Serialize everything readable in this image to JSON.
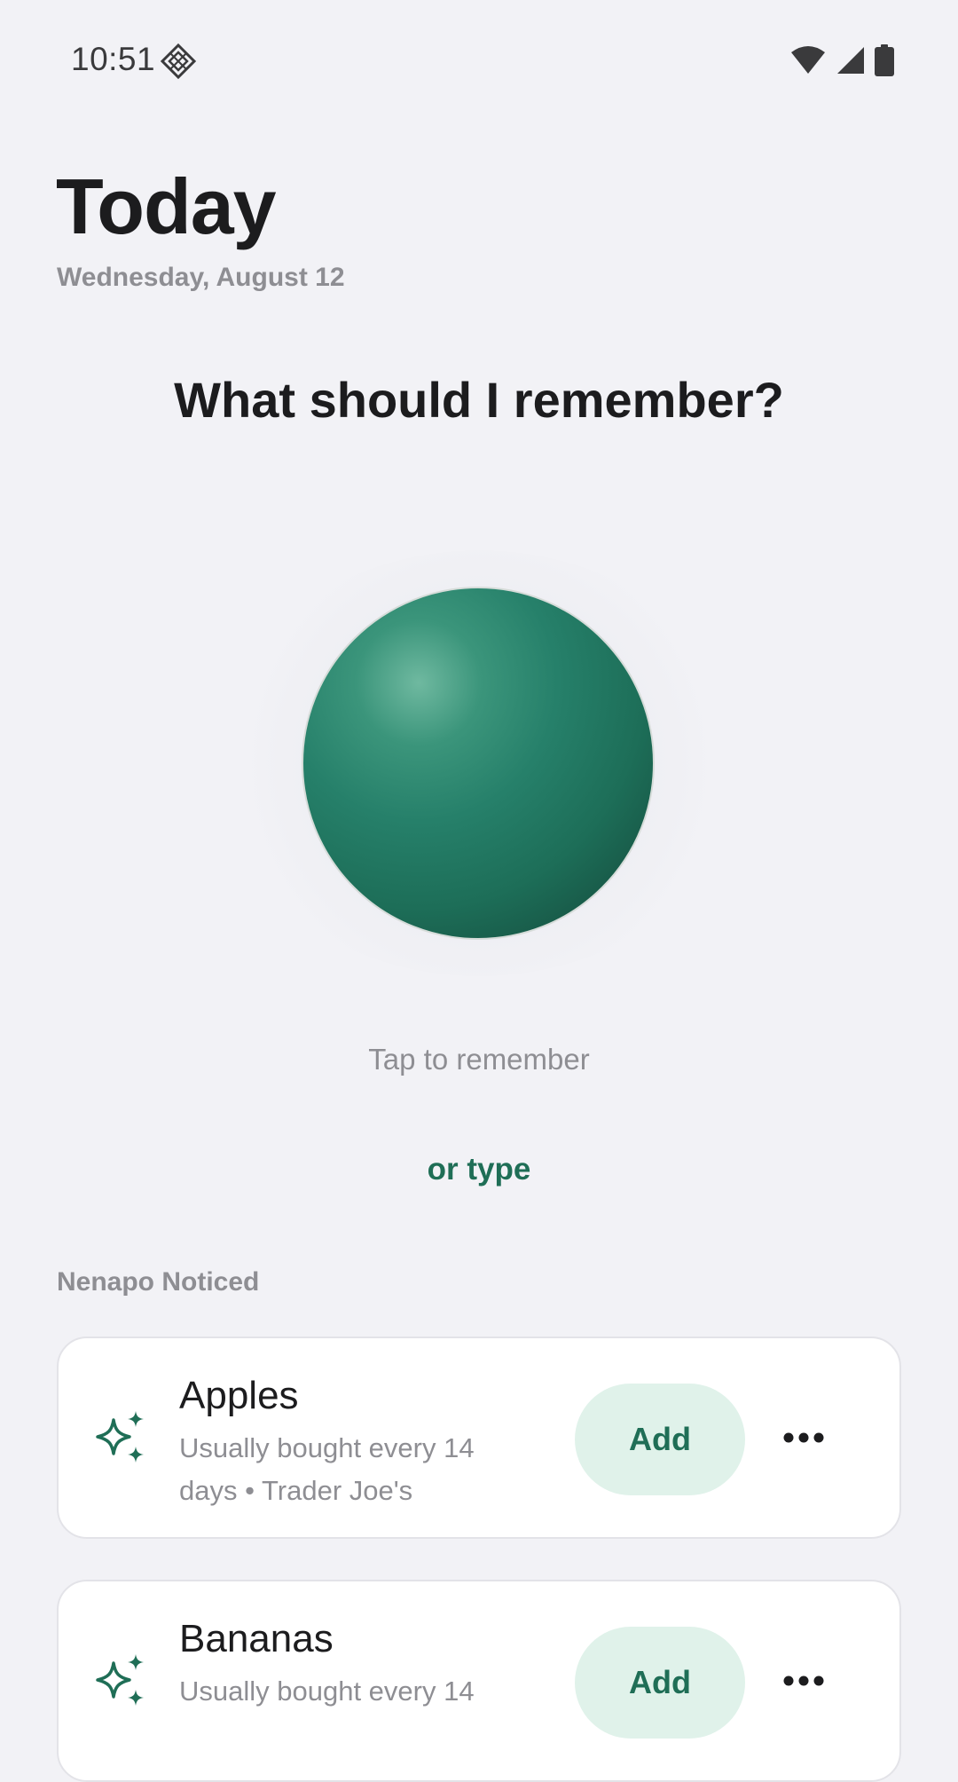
{
  "status_bar": {
    "time": "10:51",
    "app_icon": "diamond-grid-icon",
    "wifi_icon": "wifi-icon",
    "signal_icon": "cell-signal-icon",
    "battery_icon": "battery-icon"
  },
  "header": {
    "title": "Today",
    "date": "Wednesday, August 12"
  },
  "prompt": {
    "heading": "What should I remember?",
    "tap_hint": "Tap to remember",
    "type_link": "or type"
  },
  "noticed": {
    "section_label": "Nenapo Noticed",
    "items": [
      {
        "name": "Apples",
        "detail": "Usually bought every 14 days • Trader Joe's",
        "add_label": "Add",
        "icon": "sparkle-icon"
      },
      {
        "name": "Bananas",
        "detail": "Usually bought every 14",
        "add_label": "Add",
        "icon": "sparkle-icon"
      }
    ]
  },
  "colors": {
    "background": "#f2f2f6",
    "accent": "#1f6e56",
    "accent_soft": "#e0f2ea",
    "orb": "#1d6e58",
    "muted_text": "#8e8e93"
  }
}
